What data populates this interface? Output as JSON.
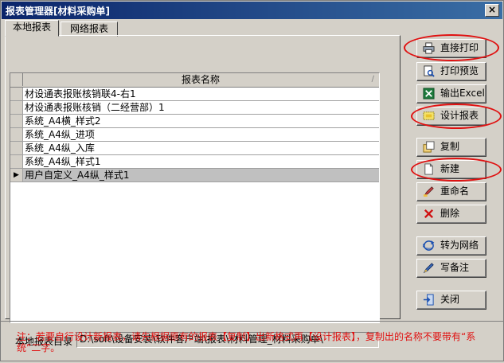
{
  "window": {
    "title": "报表管理器[材料采购单]",
    "close_label": "×"
  },
  "tabs": [
    {
      "label": "本地报表"
    },
    {
      "label": "网络报表"
    }
  ],
  "grid": {
    "column_header": "报表名称",
    "rows": [
      {
        "name": "材设通表报账核销联4-右1"
      },
      {
        "name": "材设通表报账核销（二经营部）1"
      },
      {
        "name": "系统_A4横_样式2"
      },
      {
        "name": "系统_A4纵_进项"
      },
      {
        "name": "系统_A4纵_入库"
      },
      {
        "name": "系统_A4纵_样式1"
      },
      {
        "name": "用户自定义_A4纵_样式1",
        "selected": true
      }
    ]
  },
  "directory": {
    "label": "本地报表目录",
    "path": "D:\\soft\\设备安装\\软件客户端\\报表\\材料管理_材料采购单\\"
  },
  "buttons": {
    "print": "直接打印",
    "preview": "打印预览",
    "excel": "输出Excel",
    "design": "设计报表",
    "copy": "复制",
    "new": "新建",
    "rename": "重命名",
    "delete": "删除",
    "to_network": "转为网络",
    "remark": "写备注",
    "close": "关闭"
  },
  "icons": {
    "print": "printer-icon",
    "preview": "preview-icon",
    "excel": "excel-icon",
    "design": "design-icon",
    "copy": "copy-icon",
    "new": "new-doc-icon",
    "rename": "rename-icon",
    "delete": "delete-icon",
    "to_network": "network-icon",
    "remark": "remark-icon",
    "close": "exit-icon"
  },
  "notice": "注：若要自行设计新报表，请先根据原有的报表【复制】出新格式再【设计报表】，复制出的名称不要带有“系统”二字。",
  "colors": {
    "highlight": "#e01010",
    "titlebar": "#0a246a",
    "notice": "#e01010"
  }
}
